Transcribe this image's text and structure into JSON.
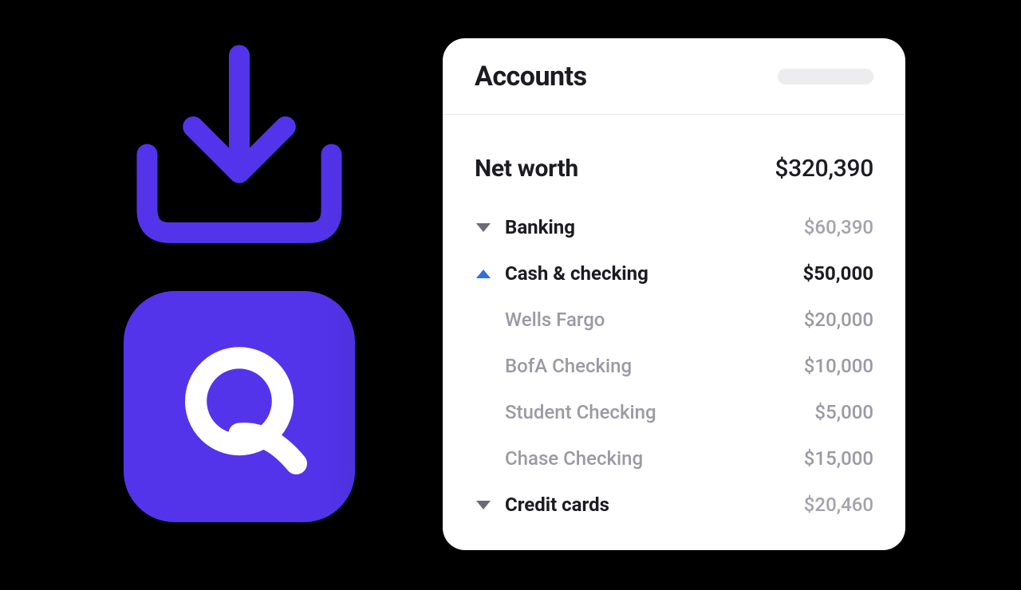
{
  "brand": {
    "accent_color": "#5434EB",
    "letter": "Q"
  },
  "card": {
    "title": "Accounts",
    "net_worth_label": "Net worth",
    "net_worth_value": "$320,390",
    "groups": [
      {
        "name": "Banking",
        "value": "$60,390",
        "expanded": true,
        "subgroups": [
          {
            "name": "Cash & checking",
            "value": "$50,000",
            "expanded": true,
            "accounts": [
              {
                "name": "Wells Fargo",
                "value": "$20,000"
              },
              {
                "name": "BofA Checking",
                "value": "$10,000"
              },
              {
                "name": "Student Checking",
                "value": "$5,000"
              },
              {
                "name": "Chase Checking",
                "value": "$15,000"
              }
            ]
          },
          {
            "name": "Credit cards",
            "value": "$20,460",
            "expanded": false,
            "accounts": []
          }
        ]
      }
    ]
  }
}
